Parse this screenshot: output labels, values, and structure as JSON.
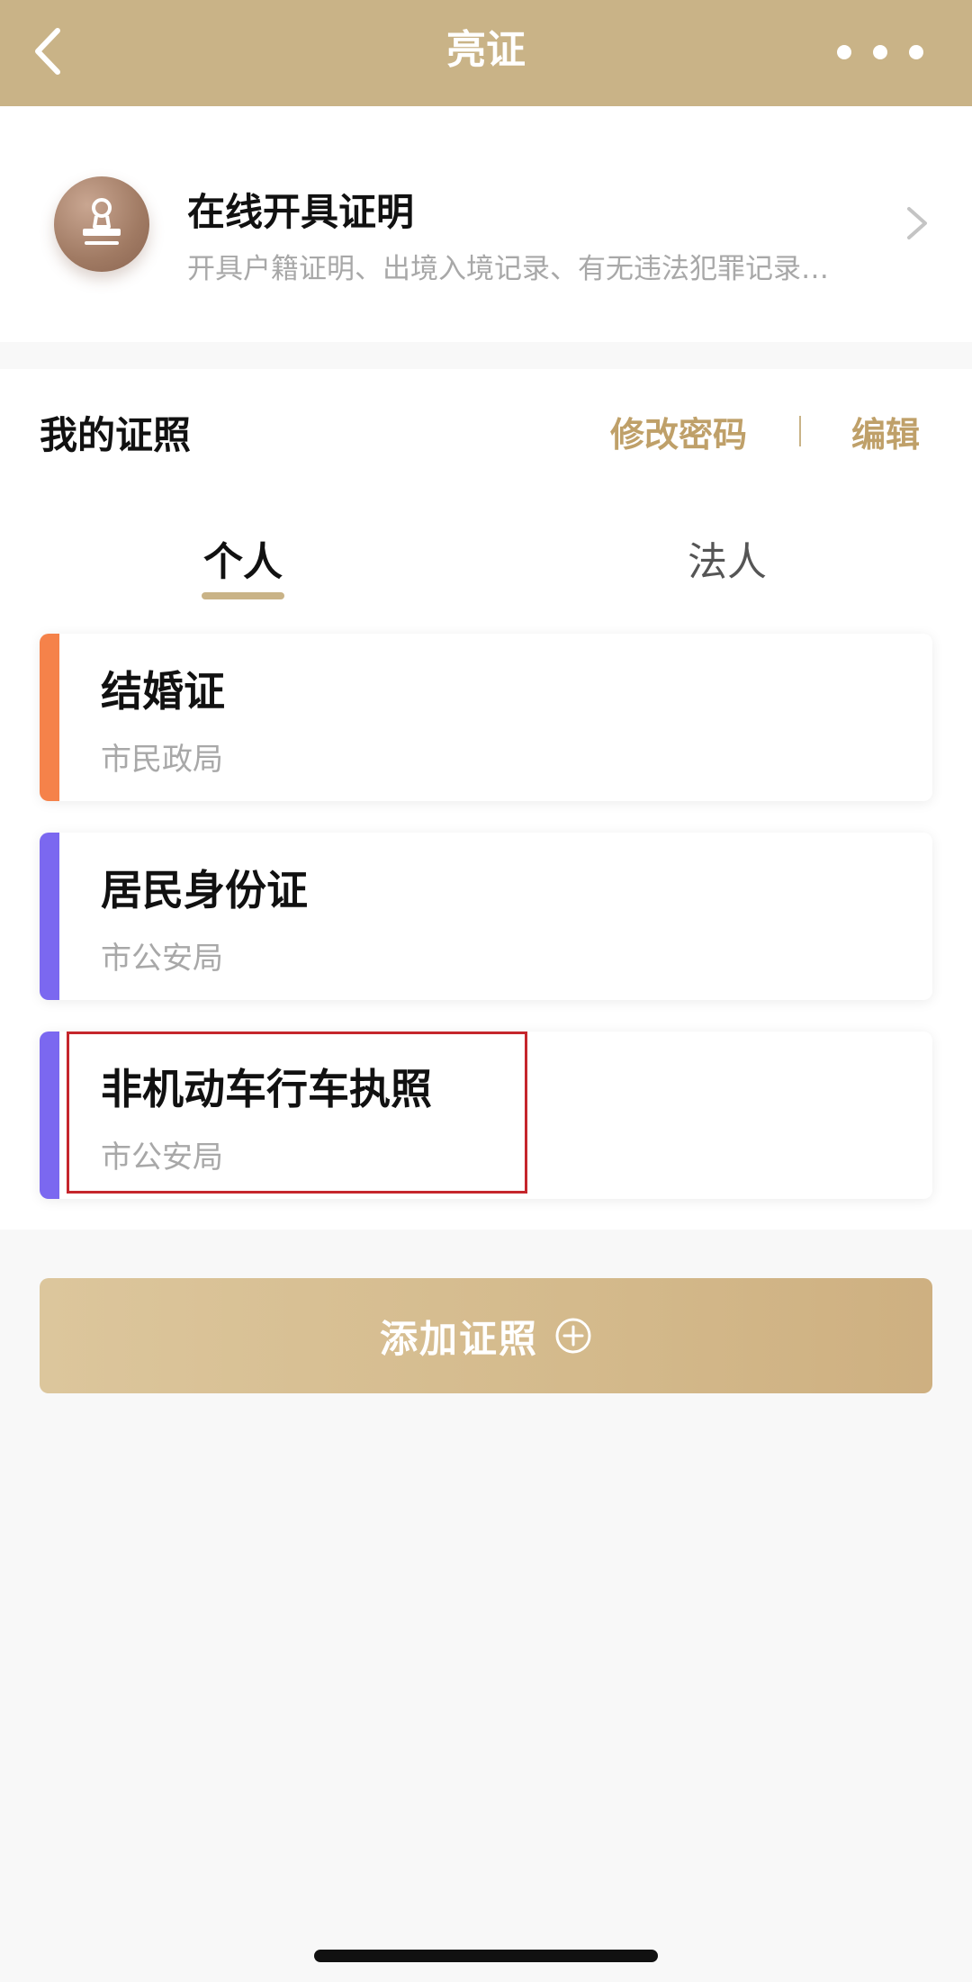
{
  "header": {
    "title": "亮证",
    "back_icon": "chevron-left-icon",
    "more_icon": "more-dots-icon",
    "background": "#c9b387"
  },
  "online_certificate": {
    "icon": "stamp-icon",
    "title": "在线开具证明",
    "subtitle": "开具户籍证明、出境入境记录、有无违法犯罪记录…"
  },
  "my_licenses": {
    "title": "我的证照",
    "change_password": "修改密码",
    "divider": "|",
    "edit": "编辑",
    "accent_color": "#bfa069"
  },
  "tabs": [
    {
      "label": "个人",
      "active": true
    },
    {
      "label": "法人",
      "active": false
    }
  ],
  "licenses": [
    {
      "name": "结婚证",
      "issuer": "市民政局",
      "stripe_color": "#f5824a"
    },
    {
      "name": "居民身份证",
      "issuer": "市公安局",
      "stripe_color": "#7b68f0"
    },
    {
      "name": "非机动车行车执照",
      "issuer": "市公安局",
      "stripe_color": "#7b68f0",
      "highlighted": true
    }
  ],
  "add_button": {
    "label": "添加证照",
    "icon": "plus-circle-icon"
  }
}
